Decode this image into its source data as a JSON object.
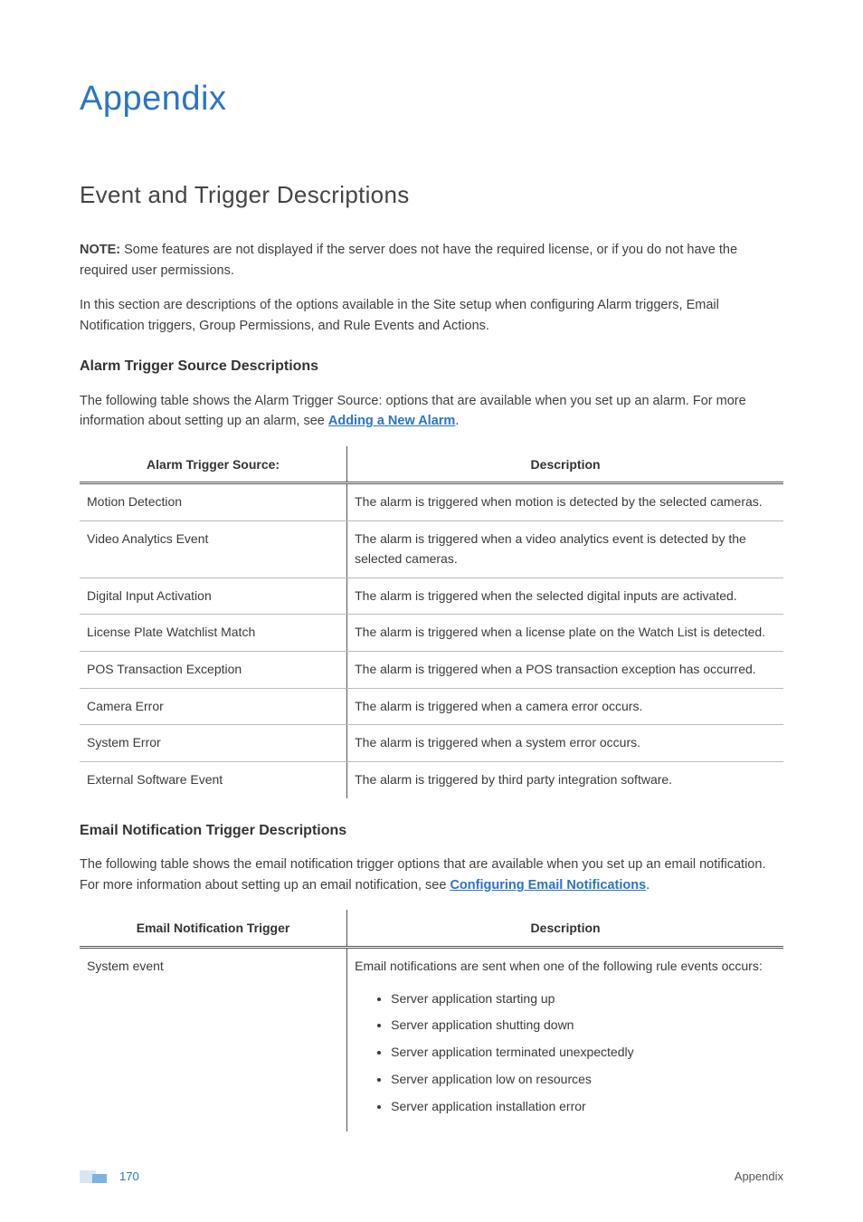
{
  "page_title": "Appendix",
  "section_title": "Event and Trigger Descriptions",
  "note": {
    "label": "NOTE:",
    "text": " Some features are not displayed if the server does not have the required license, or if you do not have the required user permissions."
  },
  "intro_para": "In this section are descriptions of the options available in the Site setup when configuring Alarm triggers, Email Notification triggers, Group Permissions, and Rule Events and Actions.",
  "alarm": {
    "heading": "Alarm Trigger Source Descriptions",
    "intro_prefix": "The following table shows the Alarm Trigger Source: options that are available when you set up an alarm. For more information about setting up an alarm, see ",
    "link_text": "Adding a New Alarm",
    "intro_suffix": ".",
    "col1": "Alarm Trigger Source:",
    "col2": "Description",
    "rows": [
      {
        "src": "Motion Detection",
        "desc": "The alarm is triggered when motion is detected by the selected cameras."
      },
      {
        "src": "Video Analytics Event",
        "desc": "The alarm is triggered when a video analytics event is detected by the selected cameras."
      },
      {
        "src": "Digital Input Activation",
        "desc": "The alarm is triggered when the selected digital inputs are activated."
      },
      {
        "src": "License Plate Watchlist Match",
        "desc": "The alarm is triggered when a license plate on the Watch List is detected."
      },
      {
        "src": "POS Transaction Exception",
        "desc": "The alarm is triggered when a POS transaction exception has occurred."
      },
      {
        "src": "Camera Error",
        "desc": "The alarm is triggered when a camera error occurs."
      },
      {
        "src": "System Error",
        "desc": "The alarm is triggered when a system error occurs."
      },
      {
        "src": "External Software Event",
        "desc": "The alarm is triggered by third party integration software."
      }
    ]
  },
  "email": {
    "heading": "Email Notification Trigger Descriptions",
    "intro_prefix": "The following table shows the email notification trigger options that are available when you set up an email notification. For more information about setting up an email notification, see ",
    "link_text": "Configuring Email Notifications",
    "intro_suffix": ".",
    "col1": "Email Notification Trigger",
    "col2": "Description",
    "row1": {
      "src": "System event",
      "desc_intro": "Email notifications are sent when one of the following rule events occurs:",
      "bullets": [
        "Server application starting up",
        "Server application shutting down",
        "Server application terminated unexpectedly",
        "Server application low on resources",
        "Server application installation error"
      ]
    }
  },
  "footer": {
    "page_num": "170",
    "label": "Appendix"
  }
}
